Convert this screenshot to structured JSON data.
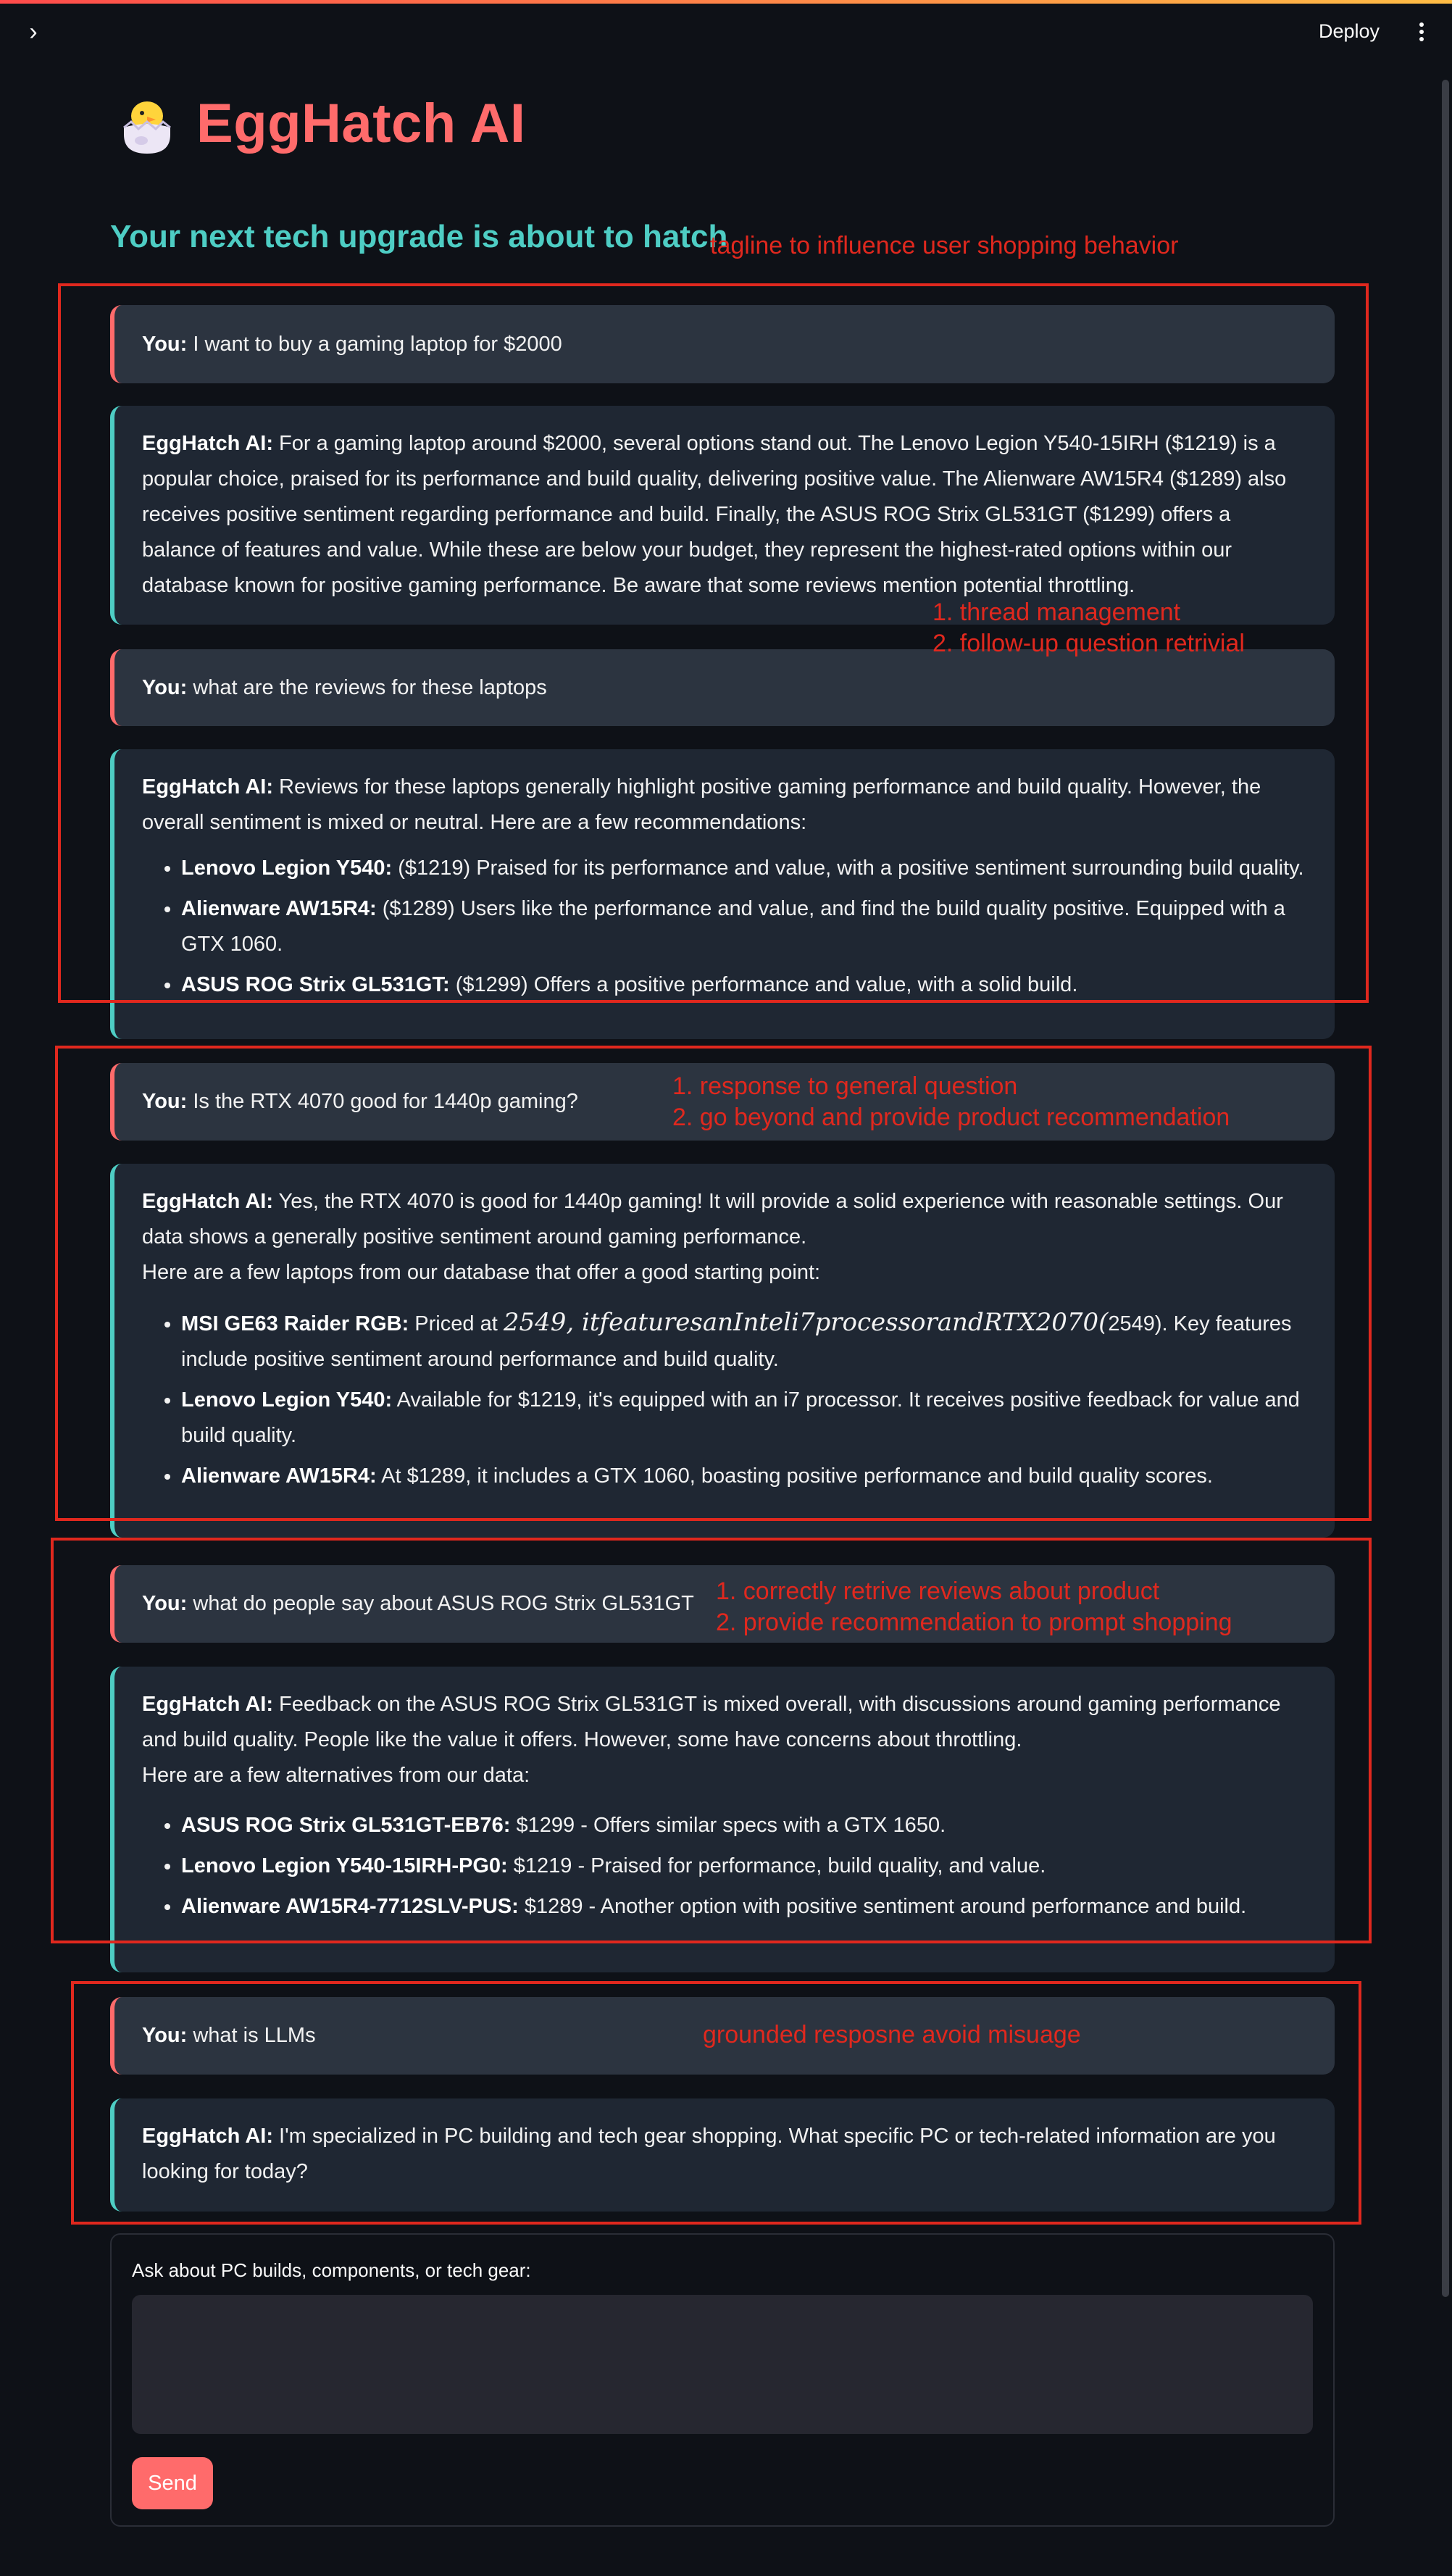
{
  "header": {
    "deploy_label": "Deploy"
  },
  "app": {
    "title": "EggHatch AI",
    "tagline": "Your next tech upgrade is about to hatch"
  },
  "chat": {
    "user_prefix": "You:",
    "ai_prefix": "EggHatch AI:",
    "messages": [
      {
        "role": "user",
        "text": " I want to buy a gaming laptop for $2000"
      },
      {
        "role": "ai",
        "text": " For a gaming laptop around $2000, several options stand out. The Lenovo Legion Y540-15IRH ($1219) is a popular choice, praised for its performance and build quality, delivering positive value. The Alienware AW15R4 ($1289) also receives positive sentiment regarding performance and build. Finally, the ASUS ROG Strix GL531GT ($1299) offers a balance of features and value. While these are below your budget, they represent the highest-rated options within our database known for positive gaming performance. Be aware that some reviews mention potential throttling."
      },
      {
        "role": "user",
        "text": " what are the reviews for these laptops"
      },
      {
        "role": "ai",
        "text": " Reviews for these laptops generally highlight positive gaming performance and build quality. However, the overall sentiment is mixed or neutral. Here are a few recommendations:",
        "items": [
          {
            "name": "Lenovo Legion Y540:",
            "text": " ($1219) Praised for its performance and value, with a positive sentiment surrounding build quality."
          },
          {
            "name": "Alienware AW15R4:",
            "text": " ($1289) Users like the performance and value, and find the build quality positive. Equipped with a GTX 1060."
          },
          {
            "name": "ASUS ROG Strix GL531GT:",
            "text": " ($1299) Offers a positive performance and value, with a solid build."
          }
        ]
      },
      {
        "role": "user",
        "text": " Is the RTX 4070 good for 1440p gaming?"
      },
      {
        "role": "ai",
        "text": " Yes, the RTX 4070 is good for 1440p gaming! It will provide a solid experience with reasonable settings. Our data shows a generally positive sentiment around gaming performance.",
        "text2": "Here are a few laptops from our database that offer a good starting point:",
        "items": [
          {
            "name": "MSI GE63 Raider RGB:",
            "text": " Priced at ",
            "math": "2549, itfeaturesanInteli7processorandRTX2070(",
            "text_after": "2549). Key features include positive sentiment around performance and build quality."
          },
          {
            "name": "Lenovo Legion Y540:",
            "text": " Available for $1219, it's equipped with an i7 processor. It receives positive feedback for value and build quality."
          },
          {
            "name": "Alienware AW15R4:",
            "text": " At $1289, it includes a GTX 1060, boasting positive performance and build quality scores."
          }
        ]
      },
      {
        "role": "user",
        "text": " what do people say about ASUS ROG Strix GL531GT"
      },
      {
        "role": "ai",
        "text": " Feedback on the ASUS ROG Strix GL531GT is mixed overall, with discussions around gaming performance and build quality. People like the value it offers. However, some have concerns about throttling.",
        "text2": "Here are a few alternatives from our data:",
        "items": [
          {
            "name": "ASUS ROG Strix GL531GT-EB76:",
            "text": " $1299 - Offers similar specs with a GTX 1650."
          },
          {
            "name": "Lenovo Legion Y540-15IRH-PG0:",
            "text": " $1219 - Praised for performance, build quality, and value."
          },
          {
            "name": "Alienware AW15R4-7712SLV-PUS:",
            "text": " $1289 - Another option with positive sentiment around performance and build."
          }
        ]
      },
      {
        "role": "user",
        "text": " what is LLMs"
      },
      {
        "role": "ai",
        "text": " I'm specialized in PC building and tech gear shopping. What specific PC or tech-related information are you looking for today?"
      }
    ]
  },
  "annotations": {
    "tagline_note": "tagline to influence user shopping behavior",
    "note1_line1": "1. thread management",
    "note1_line2": "2. follow-up question retrivial",
    "note2_line1": "1. response to general question",
    "note2_line2": "2. go beyond and provide product recommendation",
    "note3_line1": "1. correctly retrive reviews about product",
    "note3_line2": "2. provide recommendation to prompt shopping",
    "note4": "grounded resposne avoid misuage",
    "color": "#e0281e"
  },
  "input": {
    "label": "Ask about PC builds, components, or tech gear:",
    "value": "",
    "send_label": "Send"
  },
  "colors": {
    "background": "#0e1117",
    "accent": "#ff6b6b",
    "tagline": "#4ecdc4",
    "user_bubble": "#2c3440",
    "ai_bubble": "#1f2733"
  }
}
